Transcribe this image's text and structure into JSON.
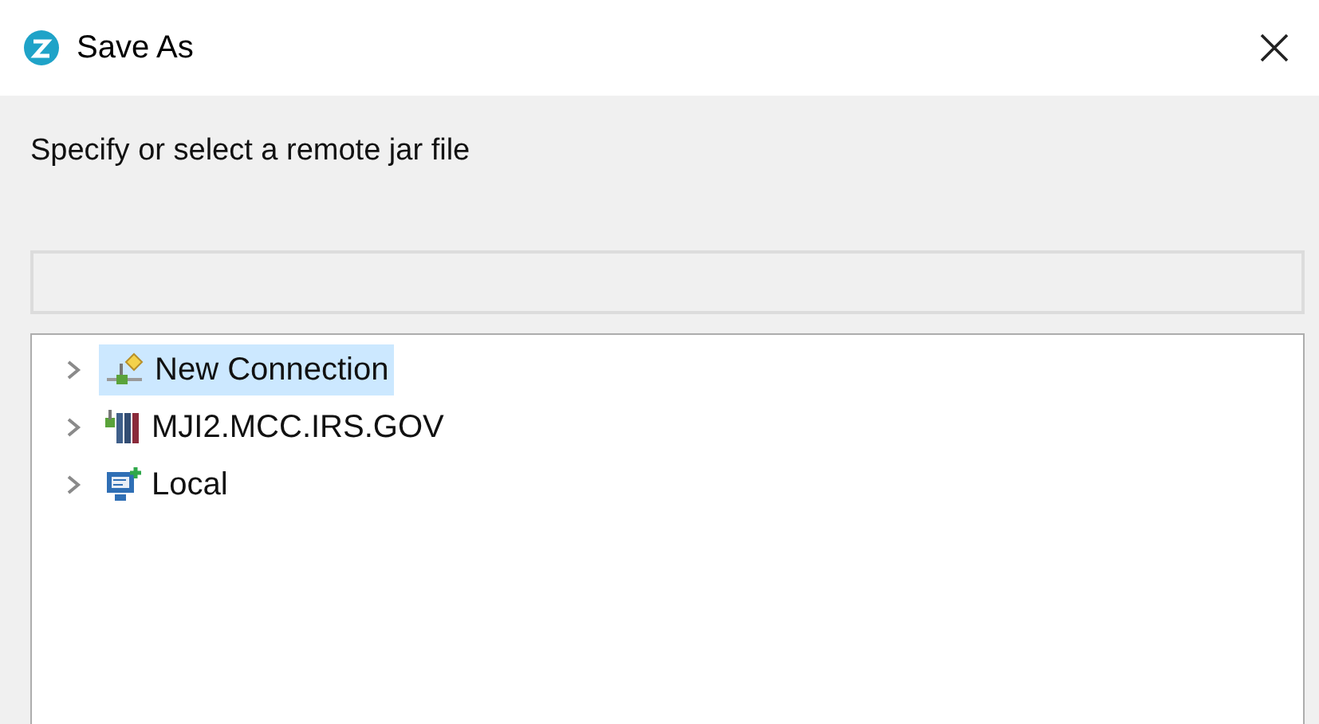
{
  "window": {
    "title": "Save As"
  },
  "message": "Specify or select a remote jar file",
  "path_field": {
    "disabled": true
  },
  "tree": {
    "items": [
      {
        "label": "New Connection",
        "kind": "new-connection",
        "selected": true,
        "expanded": false
      },
      {
        "label": "MJI2.MCC.IRS.GOV",
        "kind": "host",
        "selected": false,
        "expanded": false
      },
      {
        "label": "Local",
        "kind": "local",
        "selected": false,
        "expanded": false
      }
    ]
  }
}
